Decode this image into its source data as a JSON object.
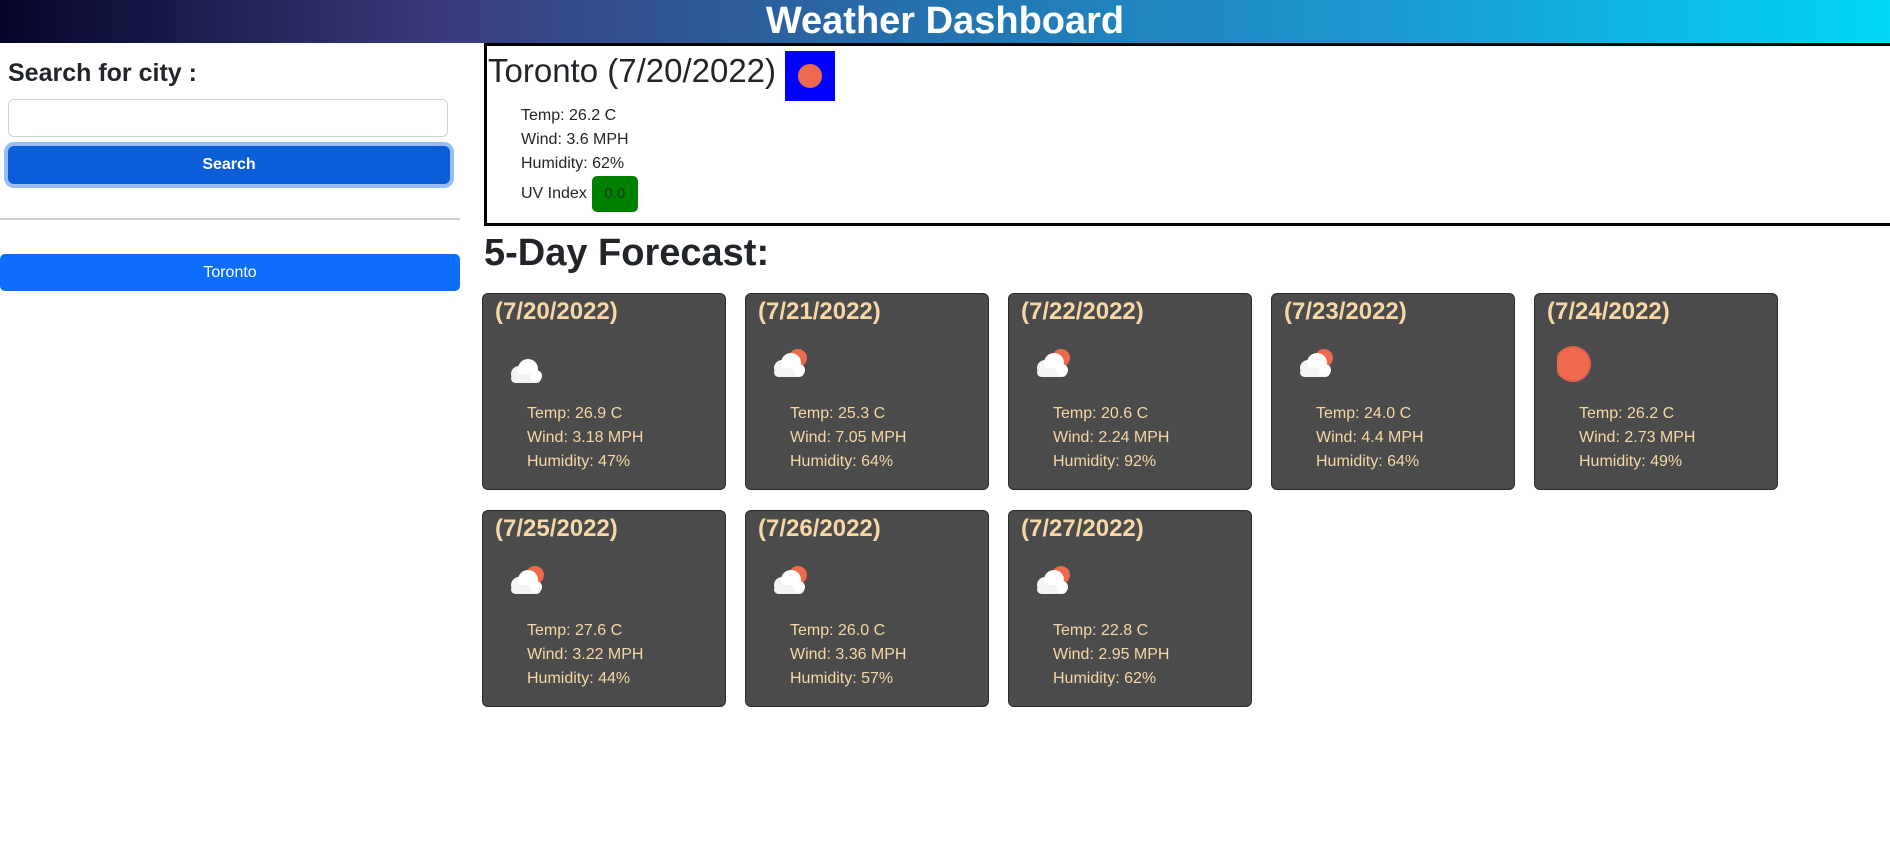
{
  "header": {
    "title": "Weather Dashboard"
  },
  "sidebar": {
    "search_label": "Search for city :",
    "search_value": "",
    "search_placeholder": "",
    "search_button": "Search",
    "history": [
      "Toronto"
    ]
  },
  "current": {
    "title": "Toronto (7/20/2022)",
    "icon": "sun-icon",
    "temp": "Temp: 26.2 C",
    "wind": "Wind: 3.6 MPH",
    "humidity": "Humidity: 62%",
    "uv_label": "UV Index",
    "uv_value": "0.0"
  },
  "forecast": {
    "heading": "5-Day Forecast:",
    "days": [
      {
        "date": "(7/20/2022)",
        "icon": "cloud-icon",
        "temp": "Temp: 26.9 C",
        "wind": "Wind: 3.18 MPH",
        "humidity": "Humidity: 47%"
      },
      {
        "date": "(7/21/2022)",
        "icon": "partly-cloudy-icon",
        "temp": "Temp: 25.3 C",
        "wind": "Wind: 7.05 MPH",
        "humidity": "Humidity: 64%"
      },
      {
        "date": "(7/22/2022)",
        "icon": "partly-cloudy-icon",
        "temp": "Temp: 20.6 C",
        "wind": "Wind: 2.24 MPH",
        "humidity": "Humidity: 92%"
      },
      {
        "date": "(7/23/2022)",
        "icon": "partly-cloudy-icon",
        "temp": "Temp: 24.0 C",
        "wind": "Wind: 4.4 MPH",
        "humidity": "Humidity: 64%"
      },
      {
        "date": "(7/24/2022)",
        "icon": "sun-icon",
        "temp": "Temp: 26.2 C",
        "wind": "Wind: 2.73 MPH",
        "humidity": "Humidity: 49%"
      },
      {
        "date": "(7/25/2022)",
        "icon": "partly-cloudy-icon",
        "temp": "Temp: 27.6 C",
        "wind": "Wind: 3.22 MPH",
        "humidity": "Humidity: 44%"
      },
      {
        "date": "(7/26/2022)",
        "icon": "partly-cloudy-icon",
        "temp": "Temp: 26.0 C",
        "wind": "Wind: 3.36 MPH",
        "humidity": "Humidity: 57%"
      },
      {
        "date": "(7/27/2022)",
        "icon": "partly-cloudy-icon",
        "temp": "Temp: 22.8 C",
        "wind": "Wind: 2.95 MPH",
        "humidity": "Humidity: 62%"
      }
    ]
  },
  "colors": {
    "card_bg": "#4b4b4b",
    "card_text": "#f6d7a7",
    "uv_badge": "#008000",
    "primary_button": "#0d6efd",
    "current_icon_bg": "#0000ff",
    "sun": "#ee6a4f"
  }
}
